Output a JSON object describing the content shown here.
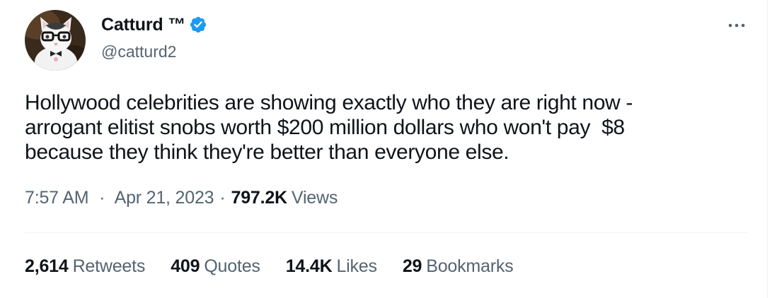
{
  "author": {
    "display_name": "Catturd ™",
    "handle": "@catturd2",
    "verified_color": "#1d9bf0"
  },
  "tweet": {
    "text": "Hollywood celebrities are showing exactly who they are right now -\narrogant elitist snobs worth $200 million dollars who won't pay  $8\nbecause they think they're better than everyone else.",
    "time": "7:57 AM",
    "date": "Apr 21, 2023",
    "separator": "·",
    "views_count": "797.2K",
    "views_label": "Views"
  },
  "stats": {
    "retweets": {
      "count": "2,614",
      "label": "Retweets"
    },
    "quotes": {
      "count": "409",
      "label": "Quotes"
    },
    "likes": {
      "count": "14.4K",
      "label": "Likes"
    },
    "bookmarks": {
      "count": "29",
      "label": "Bookmarks"
    }
  },
  "icons": {
    "avatar": "cat-with-glasses-avatar",
    "verified": "verified-badge-icon",
    "more": "more-options-icon"
  }
}
